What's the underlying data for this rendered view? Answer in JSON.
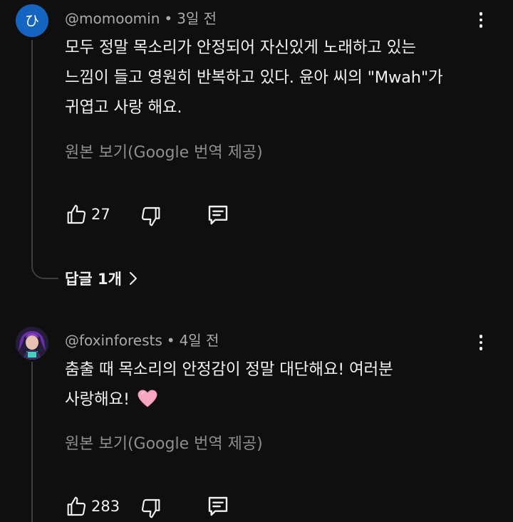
{
  "comments": [
    {
      "avatar_letter": "ひ",
      "avatar_color": "#1565c0",
      "handle": "@momoomin",
      "separator": "•",
      "time": "3일 전",
      "lines": [
        "모두 정말 목소리가 안정되어 자신있게 노래하고 있는",
        "느낌이 들고 영원히 반복하고 있다. 윤아 씨의 \"Mwah\"가",
        "귀엽고 사랑 해요."
      ],
      "translate_label": "원본 보기(Google 번역 제공)",
      "like_count": "27",
      "more_icon": "more-vertical-icon",
      "replies_label": "답글 1개",
      "replies_icon": "chevron-right-icon"
    },
    {
      "avatar_icon": "avatar-illustration",
      "handle": "@foxinforests",
      "separator": "•",
      "time": "4일 전",
      "lines": [
        "춤출 때 목소리의 안정감이 정말 대단해요! 여러분",
        "사랑해요!"
      ],
      "emoji_icon": "pink-heart-emoji",
      "translate_label": "원본 보기(Google 번역 제공)",
      "like_count": "283",
      "more_icon": "more-vertical-icon"
    }
  ],
  "colors": {
    "background": "#0f0f0f",
    "text_primary": "#f1f1f1",
    "text_secondary": "#aaaaaa",
    "thread_line": "#3d3d3d",
    "heart": "#f8a5c2"
  }
}
